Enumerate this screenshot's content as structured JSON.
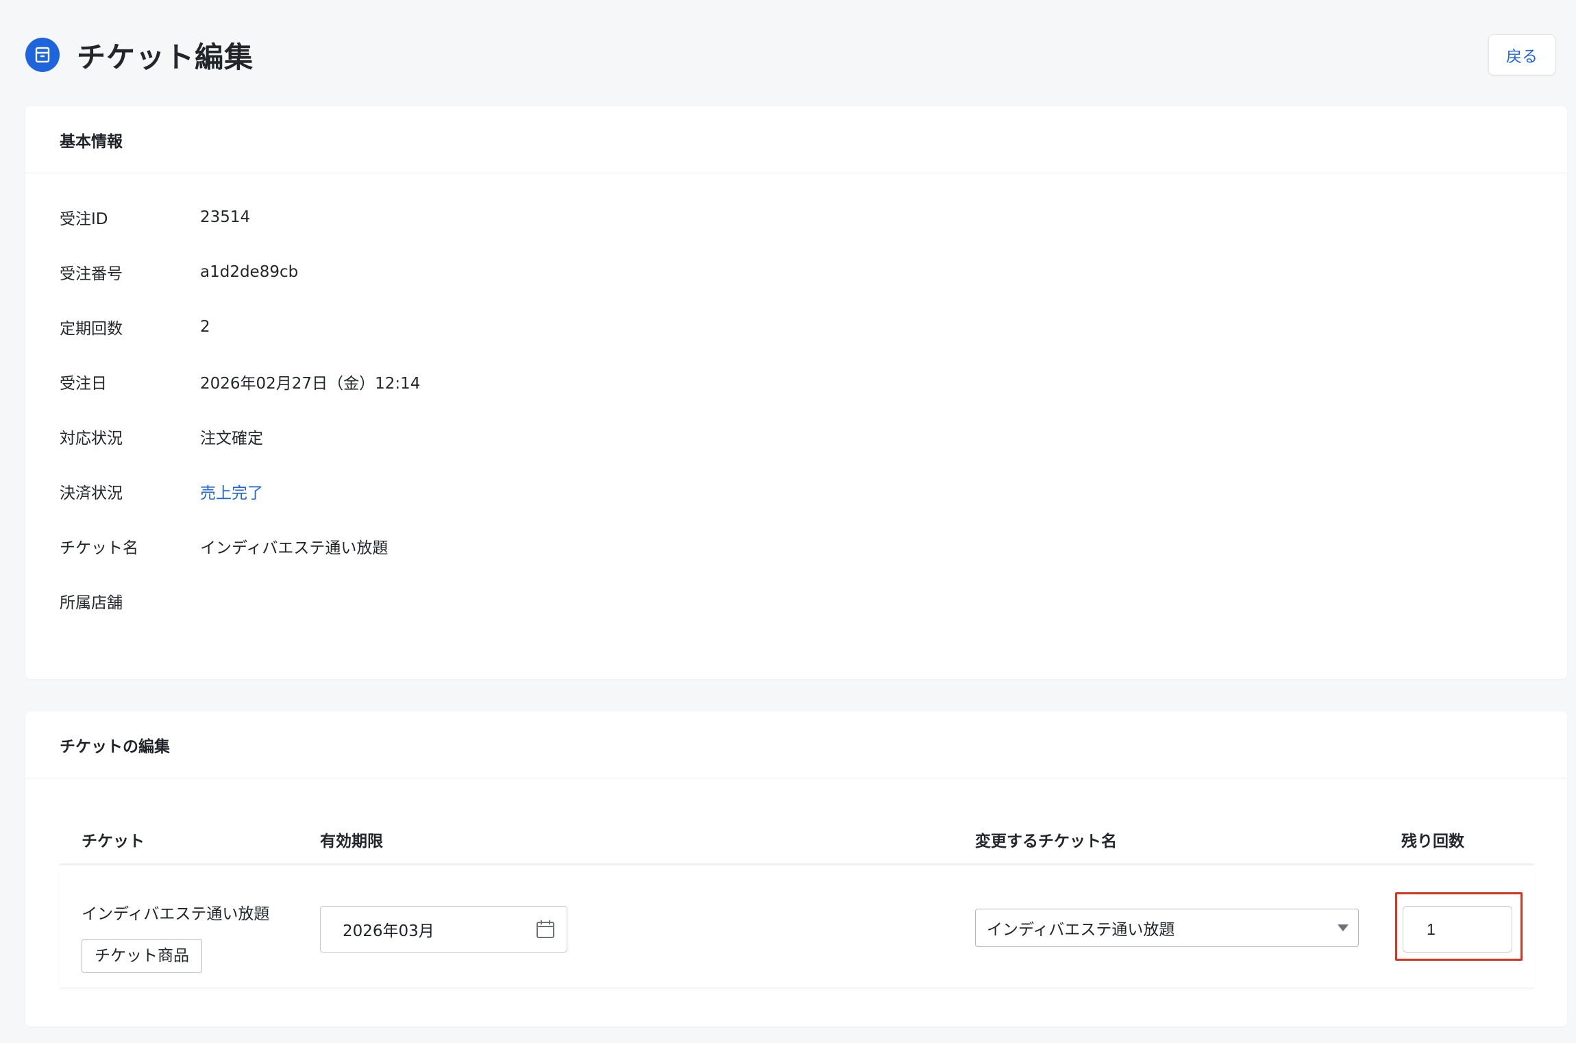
{
  "header": {
    "title": "チケット編集",
    "back_label": "戻る"
  },
  "basic_info": {
    "title": "基本情報",
    "rows": [
      {
        "label": "受注ID",
        "value": "23514"
      },
      {
        "label": "受注番号",
        "value": "a1d2de89cb"
      },
      {
        "label": "定期回数",
        "value": "2"
      },
      {
        "label": "受注日",
        "value": "2026年02月27日（金）12:14"
      },
      {
        "label": "対応状況",
        "value": "注文確定"
      },
      {
        "label": "決済状況",
        "value": "売上完了"
      },
      {
        "label": "チケット名",
        "value": "インディバエステ通い放題"
      },
      {
        "label": "所属店舗",
        "value": ""
      }
    ]
  },
  "ticket_edit": {
    "title": "チケットの編集",
    "columns": [
      "チケット",
      "有効期限",
      "変更するチケット名",
      "残り回数"
    ],
    "row": {
      "ticket_name": "インディバエステ通い放題",
      "ticket_tag": "チケット商品",
      "expiry": "2026年03月",
      "new_ticket_name": "インディバエステ通い放題",
      "remaining_count": "1"
    }
  },
  "colors": {
    "accent": "#1e64dc",
    "highlight": "#d9341f"
  }
}
